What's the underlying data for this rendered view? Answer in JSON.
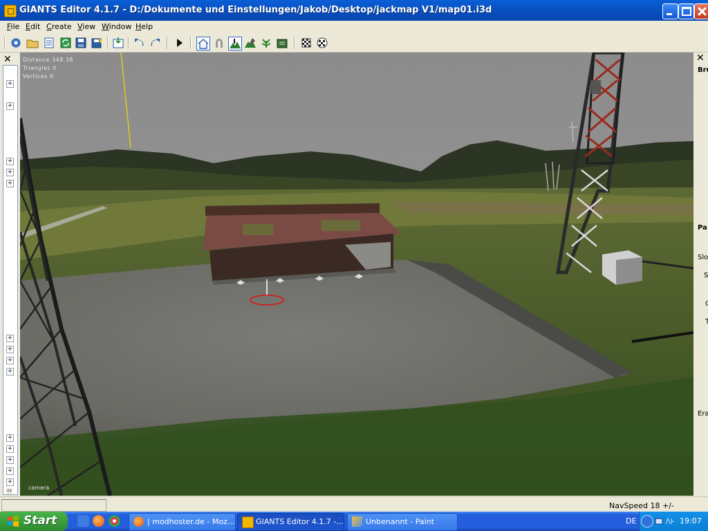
{
  "window": {
    "title": "GIANTS Editor 4.1.7 - D:/Dokumente und Einstellungen/Jakob/Desktop/jackmap V1/map01.i3d",
    "icon": "giants-editor-icon"
  },
  "menubar": {
    "items": [
      "File",
      "Edit",
      "Create",
      "View",
      "Window",
      "Help"
    ]
  },
  "toolbar": {
    "icons": [
      "settings-icon",
      "open-folder-icon",
      "list-icon",
      "refresh-icon",
      "save-icon",
      "save-as-icon",
      "import-icon",
      "undo-icon",
      "redo-icon",
      "play-icon",
      "home-icon",
      "magnet-icon",
      "terrain-sculpt-icon",
      "terrain-paint-icon",
      "foliage-paint-icon",
      "terrain-info-icon",
      "flag-icon",
      "checker-icon"
    ]
  },
  "viewport": {
    "stats": {
      "distance": "Distance 348.38",
      "triangles": "Triangles 0",
      "vertices": "Vertices 0"
    },
    "camera_label": "camera"
  },
  "right_panel": {
    "partial_labels": [
      "Bru",
      "Pa",
      "Slo",
      "S",
      "C",
      "T",
      "Era"
    ]
  },
  "statusbar": {
    "navspeed": "NavSpeed 18 +/-"
  },
  "taskbar": {
    "start_label": "Start",
    "tasks": [
      {
        "label": "| modhoster.de - Moz...",
        "icon": "firefox-icon"
      },
      {
        "label": "GIANTS Editor 4.1.7 -...",
        "icon": "giants-editor-icon"
      },
      {
        "label": "Unbenannt - Paint",
        "icon": "paint-icon"
      }
    ],
    "language": "DE",
    "clock": "19:07"
  },
  "colors": {
    "titlebar": "#0853c4",
    "taskbar": "#245edc",
    "start": "#3c9e3c",
    "sky": "#8f8f8f"
  }
}
